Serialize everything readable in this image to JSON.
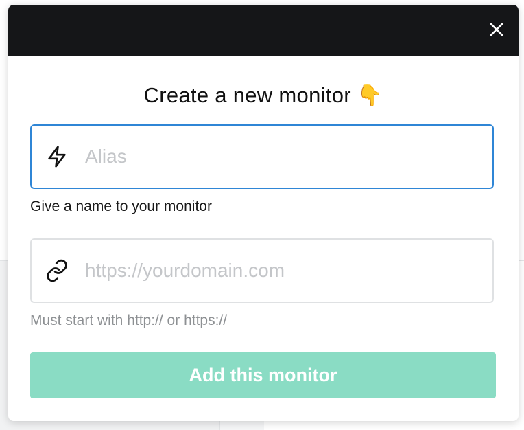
{
  "modal": {
    "title": "Create a new monitor",
    "title_emoji": "👇",
    "close_icon": "close-icon",
    "alias_field": {
      "icon": "lightning-bolt-icon",
      "placeholder": "Alias",
      "value": "",
      "helper": "Give a name to your monitor"
    },
    "url_field": {
      "icon": "link-icon",
      "placeholder": "https://yourdomain.com",
      "value": "",
      "helper": "Must start with http:// or https://"
    },
    "submit_label": "Add this monitor",
    "colors": {
      "header": "#151618",
      "focus_border": "#2f86d6",
      "submit_bg": "#8adcc4"
    }
  }
}
